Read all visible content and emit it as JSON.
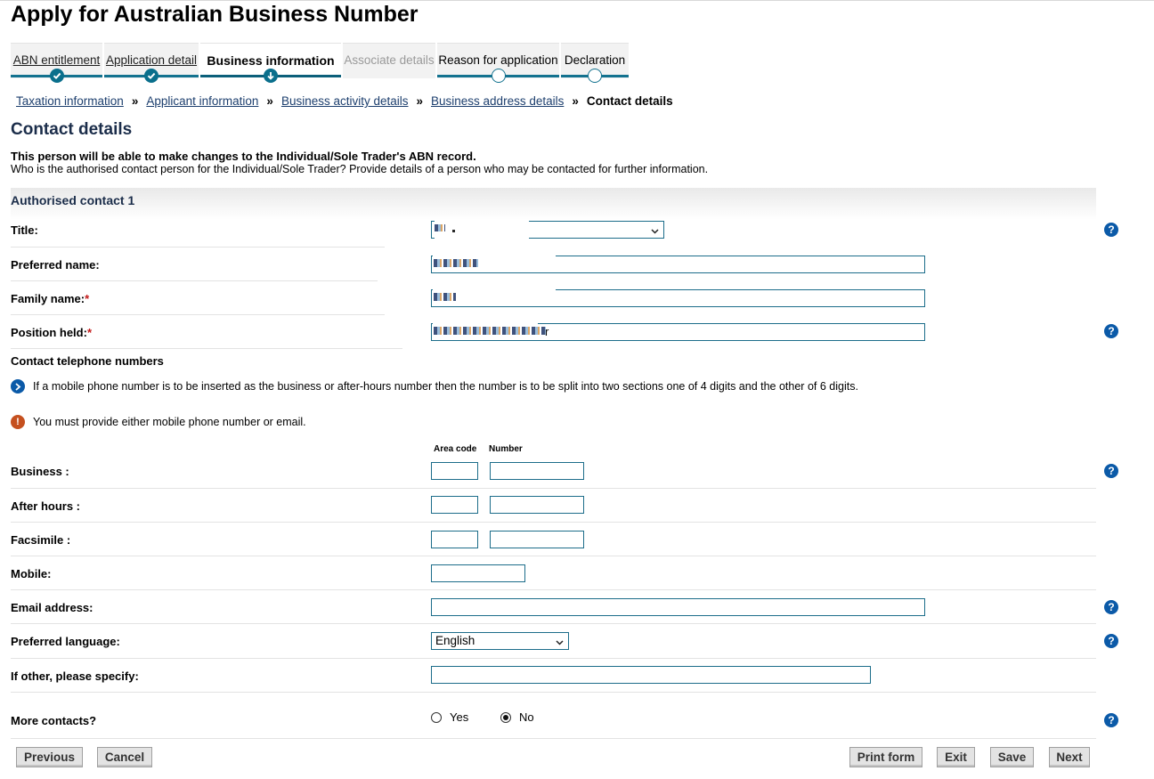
{
  "page_title": "Apply for Australian Business Number",
  "steps": [
    {
      "label": "ABN entitlement",
      "state": "done"
    },
    {
      "label": "Application detail",
      "state": "done"
    },
    {
      "label": "Business information",
      "state": "current"
    },
    {
      "label": "Associate details",
      "state": "disabled"
    },
    {
      "label": "Reason for application",
      "state": "pending"
    },
    {
      "label": "Declaration",
      "state": "pending"
    }
  ],
  "breadcrumb": {
    "items": [
      "Taxation information",
      "Applicant information",
      "Business activity details",
      "Business address details"
    ],
    "separator": "»",
    "current": "Contact details"
  },
  "section_title": "Contact details",
  "intro": {
    "bold": "This person will be able to make changes to the Individual/Sole Trader's ABN record.",
    "text": "Who is the authorised contact person for the Individual/Sole Trader? Provide details of a person who may be contacted for further information."
  },
  "contact_header": "Authorised contact 1",
  "fields": {
    "title_label": "Title:",
    "preferred_name_label": "Preferred name:",
    "family_name_label": "Family name:",
    "position_label": "Position held:",
    "required_mark": "*",
    "position_visible_tail": "r"
  },
  "phone": {
    "heading": "Contact telephone numbers",
    "info_note": "If a mobile phone number is to be inserted as the business or after-hours number then the number is to be split into two sections one of 4 digits and the other of 6 digits.",
    "warning_note": "You must provide either mobile phone number or email.",
    "col_area": "Area code",
    "col_number": "Number",
    "business_label": "Business :",
    "after_hours_label": "After hours :",
    "facsimile_label": "Facsimile :",
    "mobile_label": "Mobile:"
  },
  "email_label": "Email address:",
  "language": {
    "label": "Preferred language:",
    "selected": "English"
  },
  "other_label": "If other, please specify:",
  "more_contacts": {
    "label": "More contacts?",
    "yes": "Yes",
    "no": "No",
    "selected": "No"
  },
  "buttons": {
    "previous": "Previous",
    "cancel": "Cancel",
    "print": "Print form",
    "exit": "Exit",
    "save": "Save",
    "next": "Next"
  },
  "icons": {
    "help": "?",
    "info": ">",
    "warning": "!",
    "check": "✔",
    "select_arrow": "⌄"
  },
  "colors": {
    "accent": "#13728f",
    "help": "#0b5aa8",
    "warning": "#c5501f",
    "required": "#c31919"
  }
}
